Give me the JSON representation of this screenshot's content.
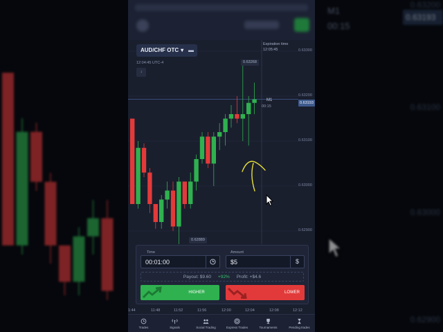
{
  "asset": {
    "name": "AUD/CHF OTC",
    "menu_icon": "dots-icon"
  },
  "chart": {
    "clock": "12:04:45 UTC-4",
    "expiration_label": "Expiration time",
    "expiration_time": "12:05:45",
    "timeframe": "M1",
    "timer": "00:15",
    "current_price": "0.63193",
    "high_marker": "0.63268",
    "low_marker": "0.62889",
    "y_ticks": [
      "0.63300",
      "0.63200",
      "0.63100",
      "0.63000",
      "0.62900"
    ],
    "x_ticks": [
      "1:44",
      "11:48",
      "11:52",
      "11:56",
      "12:00",
      "12:04",
      "12:08",
      "12:12"
    ],
    "up_color": "#2fb14f",
    "down_color": "#e23a3a",
    "candles": [
      {
        "o": 0.6315,
        "h": 0.6315,
        "l": 0.6296,
        "c": 0.6296
      },
      {
        "o": 0.6296,
        "h": 0.631,
        "l": 0.6295,
        "c": 0.63085
      },
      {
        "o": 0.63085,
        "h": 0.63095,
        "l": 0.6302,
        "c": 0.6303
      },
      {
        "o": 0.6303,
        "h": 0.6304,
        "l": 0.6294,
        "c": 0.6296
      },
      {
        "o": 0.6296,
        "h": 0.6296,
        "l": 0.62905,
        "c": 0.6292
      },
      {
        "o": 0.6292,
        "h": 0.6298,
        "l": 0.62905,
        "c": 0.6297
      },
      {
        "o": 0.6297,
        "h": 0.6301,
        "l": 0.6295,
        "c": 0.6299
      },
      {
        "o": 0.6299,
        "h": 0.6301,
        "l": 0.629,
        "c": 0.6291
      },
      {
        "o": 0.6291,
        "h": 0.6302,
        "l": 0.6287,
        "c": 0.6301
      },
      {
        "o": 0.6301,
        "h": 0.6301,
        "l": 0.6295,
        "c": 0.6296
      },
      {
        "o": 0.6296,
        "h": 0.6303,
        "l": 0.6295,
        "c": 0.6301
      },
      {
        "o": 0.6301,
        "h": 0.6307,
        "l": 0.6299,
        "c": 0.6306
      },
      {
        "o": 0.6306,
        "h": 0.6312,
        "l": 0.6305,
        "c": 0.6311
      },
      {
        "o": 0.6311,
        "h": 0.6312,
        "l": 0.6304,
        "c": 0.6305
      },
      {
        "o": 0.6305,
        "h": 0.6312,
        "l": 0.63,
        "c": 0.6311
      },
      {
        "o": 0.6311,
        "h": 0.6314,
        "l": 0.6308,
        "c": 0.6312
      },
      {
        "o": 0.6312,
        "h": 0.6316,
        "l": 0.6309,
        "c": 0.6315
      },
      {
        "o": 0.6315,
        "h": 0.6318,
        "l": 0.6313,
        "c": 0.6316
      },
      {
        "o": 0.6316,
        "h": 0.632,
        "l": 0.6314,
        "c": 0.6315
      },
      {
        "o": 0.6315,
        "h": 0.63268,
        "l": 0.631,
        "c": 0.6316
      },
      {
        "o": 0.6316,
        "h": 0.632,
        "l": 0.6309,
        "c": 0.63185
      },
      {
        "o": 0.63185,
        "h": 0.6323,
        "l": 0.6316,
        "c": 0.63193
      }
    ],
    "y_min": 0.6286,
    "y_max": 0.6331
  },
  "trade": {
    "time_label": "Time",
    "time_value": "00:01:00",
    "time_icon": "clock-icon",
    "amount_label": "Amount",
    "amount_value": "$5",
    "currency_symbol": "$",
    "payout_text": "Payout: $9.60",
    "payout_pct": "+92%",
    "profit_text": "Profit: +$4.6",
    "higher_label": "HIGHER",
    "lower_label": "LOWER"
  },
  "nav": [
    {
      "label": "Trades",
      "icon": "history-icon"
    },
    {
      "label": "Signals",
      "icon": "signal-icon"
    },
    {
      "label": "Social Trading",
      "icon": "people-icon"
    },
    {
      "label": "Express Trades",
      "icon": "target-icon"
    },
    {
      "label": "Tournaments",
      "icon": "trophy-icon"
    },
    {
      "label": "Pending trades",
      "icon": "hourglass-icon"
    }
  ],
  "background": {
    "timeframe": "M1",
    "timer": "00:15",
    "current_price": "0.63193",
    "y_ticks": [
      "0.63200",
      "0.63100",
      "0.63000",
      "0.62900"
    ]
  }
}
